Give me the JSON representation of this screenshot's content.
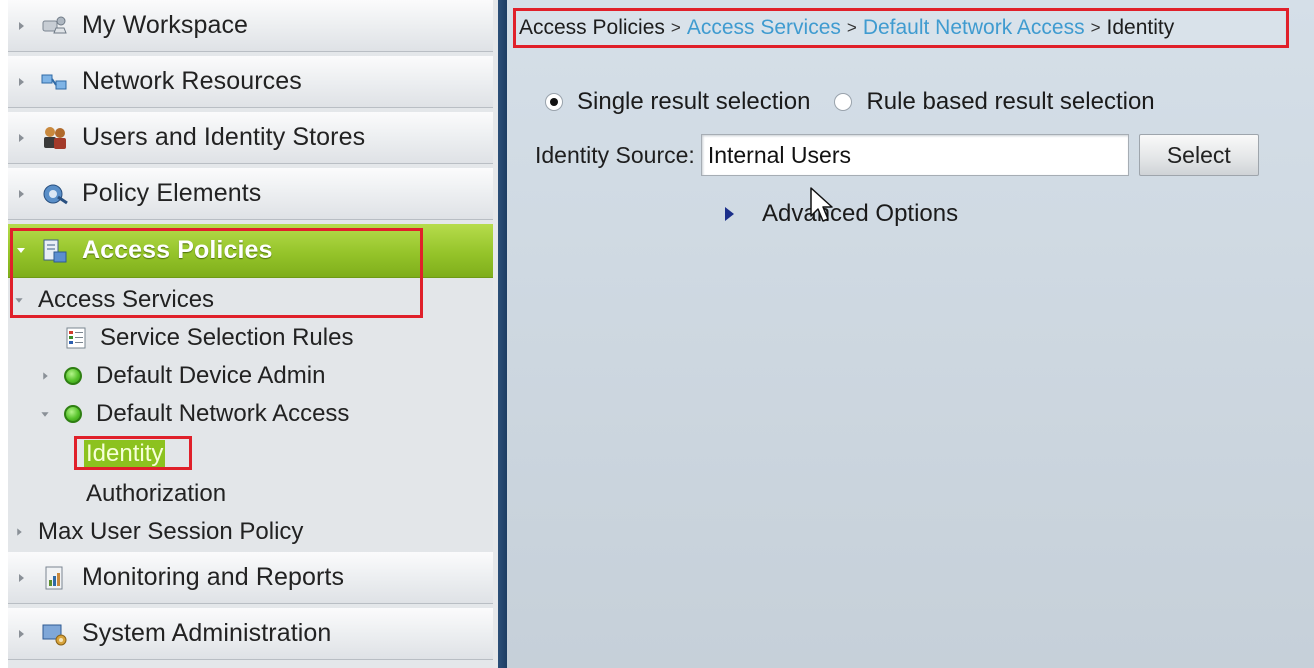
{
  "sidebar": {
    "drawers_top": [
      {
        "label": "My Workspace",
        "icon": "workspace-icon"
      },
      {
        "label": "Network Resources",
        "icon": "network-icon"
      },
      {
        "label": "Users and Identity Stores",
        "icon": "users-icon"
      },
      {
        "label": "Policy Elements",
        "icon": "policy-elements-icon"
      }
    ],
    "active_drawer": {
      "label": "Access Policies",
      "icon": "access-policies-icon"
    },
    "tree": {
      "access_services": "Access Services",
      "service_selection_rules": "Service Selection Rules",
      "default_device_admin": "Default Device Admin",
      "default_network_access": "Default Network Access",
      "identity": "Identity",
      "authorization": "Authorization",
      "max_user_session_policy": "Max User Session Policy"
    },
    "drawers_bottom": [
      {
        "label": "Monitoring and Reports",
        "icon": "monitoring-icon"
      },
      {
        "label": "System Administration",
        "icon": "system-admin-icon"
      }
    ]
  },
  "breadcrumb": {
    "items": [
      "Access Policies",
      "Access Services",
      "Default Network Access",
      "Identity"
    ],
    "separator": ">"
  },
  "main": {
    "radio_single_label": "Single result selection",
    "radio_rule_label": "Rule based result selection",
    "selected_radio": "single",
    "identity_source_label": "Identity Source:",
    "identity_source_value": "Internal Users",
    "select_button": "Select",
    "advanced_options": "Advanced Options"
  },
  "colors": {
    "active_green": "#95c42a",
    "highlight_red": "#e0202a",
    "link_blue": "#3f9bd0",
    "divider_navy": "#1d3d63"
  }
}
